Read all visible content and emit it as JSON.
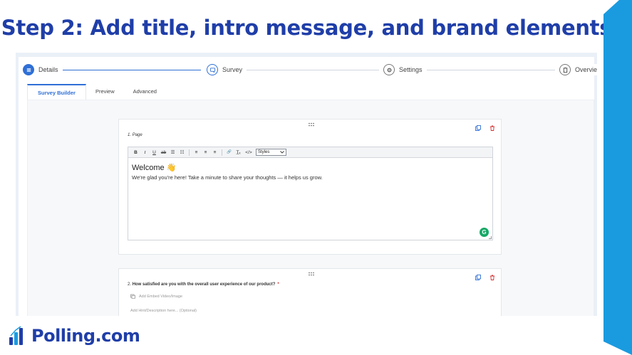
{
  "slide": {
    "title": "Step 2: Add title, intro message, and brand elements",
    "brand_name": "Polling.com",
    "colors": {
      "title": "#1f3ea8",
      "accent": "#1a9be0",
      "primary": "#2f6fd6",
      "danger": "#d23030"
    }
  },
  "stepper": {
    "steps": [
      {
        "label": "Details",
        "state": "done",
        "icon": "list-icon"
      },
      {
        "label": "Survey",
        "state": "active",
        "icon": "survey-icon"
      },
      {
        "label": "Settings",
        "state": "pending",
        "icon": "gear-icon"
      },
      {
        "label": "Overview",
        "state": "pending",
        "icon": "clipboard-icon"
      }
    ]
  },
  "tabs": [
    {
      "label": "Survey Builder",
      "active": true
    },
    {
      "label": "Preview",
      "active": false
    },
    {
      "label": "Advanced",
      "active": false
    }
  ],
  "questions": [
    {
      "number": "1.",
      "label": "Page",
      "editor": {
        "styles_label": "Styles",
        "welcome": "Welcome 👋",
        "intro": "We're glad you're here! Take a minute to share your thoughts — it helps us grow."
      }
    },
    {
      "number": "2.",
      "label": "How satisfied are you with the overall user experience of our product?",
      "required_mark": "*",
      "embed_label": "Add Embed Video/Image",
      "hint_placeholder": "Add Hint/Description here... (Optional)"
    }
  ],
  "toolbar": {
    "bold": "B",
    "italic": "I",
    "underline": "U",
    "strike": "ab",
    "ordered_list": "☰",
    "bullet_list": "☷",
    "align_left": "≡",
    "align_center": "≡",
    "align_right": "≡",
    "link": "🔗",
    "clear_format": "T̲ₓ",
    "code": "</>"
  }
}
